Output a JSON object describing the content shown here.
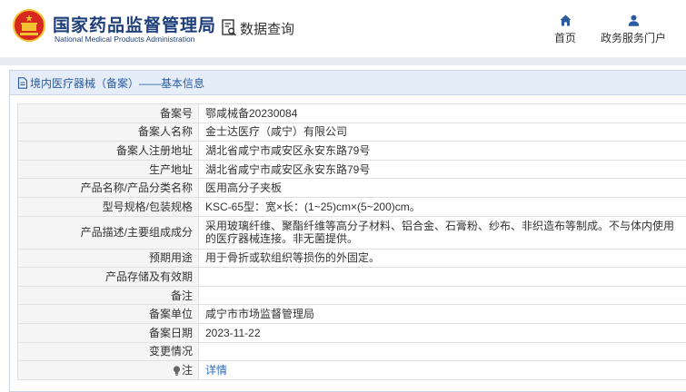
{
  "header": {
    "org_name_cn": "国家药品监督管理局",
    "org_name_en": "National Medical Products Administration",
    "query_label": "数据查询",
    "nav": [
      {
        "label": "首页",
        "icon": "home-icon"
      },
      {
        "label": "政务服务门户",
        "icon": "user-icon"
      }
    ]
  },
  "panel": {
    "title": "境内医疗器械（备案）——基本信息"
  },
  "details": [
    {
      "label": "备案号",
      "value": "鄂咸械备20230084"
    },
    {
      "label": "备案人名称",
      "value": "金士达医疗（咸宁）有限公司"
    },
    {
      "label": "备案人注册地址",
      "value": "湖北省咸宁市咸安区永安东路79号"
    },
    {
      "label": "生产地址",
      "value": "湖北省咸宁市咸安区永安东路79号"
    },
    {
      "label": "产品名称/产品分类名称",
      "value": "医用高分子夹板"
    },
    {
      "label": "型号规格/包装规格",
      "value": "KSC-65型：宽×长：(1~25)cm×(5~200)cm。"
    },
    {
      "label": "产品描述/主要组成成分",
      "value": "采用玻璃纤维、聚酯纤维等高分子材料、铝合金、石膏粉、纱布、非织造布等制成。不与体内使用的医疗器械连接。非无菌提供。"
    },
    {
      "label": "预期用途",
      "value": "用于骨折或软组织等损伤的外固定。"
    },
    {
      "label": "产品存储及有效期",
      "value": ""
    },
    {
      "label": "备注",
      "value": ""
    },
    {
      "label": "备案单位",
      "value": "咸宁市市场监督管理局"
    },
    {
      "label": "备案日期",
      "value": "2023-11-22"
    },
    {
      "label": "变更情况",
      "value": ""
    }
  ],
  "note_row": {
    "label": "注",
    "link": "详情",
    "icon": "lightbulb-icon"
  },
  "colors": {
    "brand_blue": "#1e3f7a",
    "link_blue": "#2e6dbd",
    "emblem_red": "#d7271f",
    "emblem_gold": "#f2c230"
  }
}
